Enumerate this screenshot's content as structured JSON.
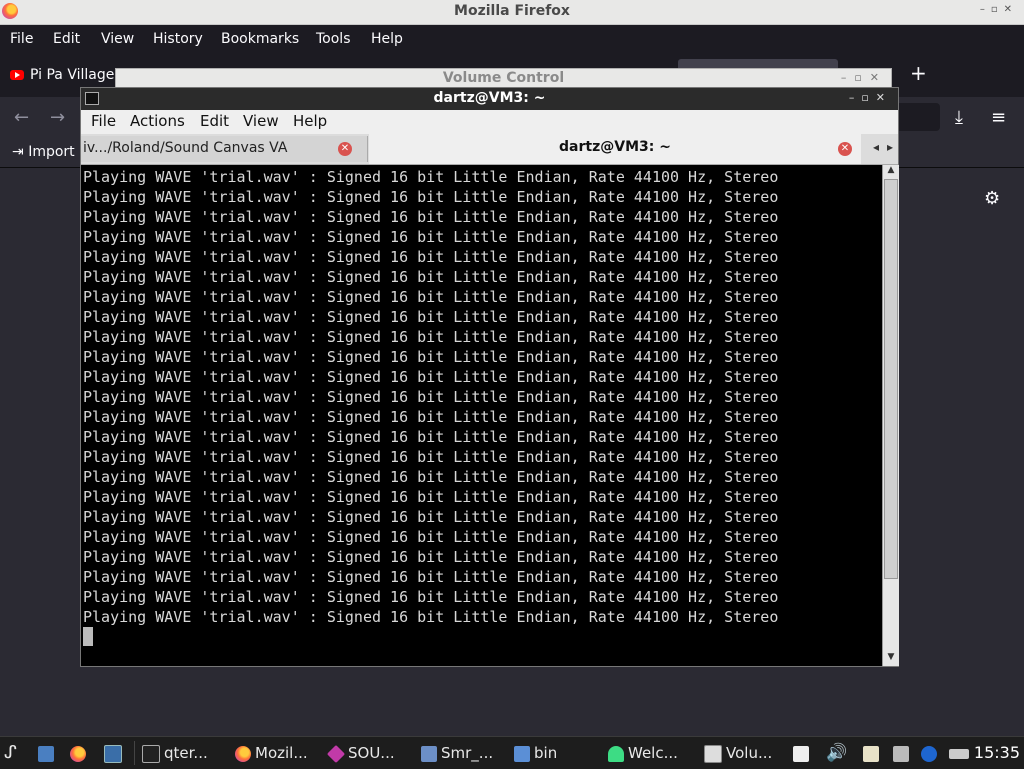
{
  "firefox": {
    "window_title": "Mozilla Firefox",
    "menu": [
      "File",
      "Edit",
      "View",
      "History",
      "Bookmarks",
      "Tools",
      "Help"
    ],
    "tab_label": "Pi Pa Village",
    "bookmark_label": "Import"
  },
  "volume_control": {
    "window_title": "Volume Control"
  },
  "terminal": {
    "window_title": "dartz@VM3: ~",
    "menu": [
      "File",
      "Actions",
      "Edit",
      "View",
      "Help"
    ],
    "tabs": [
      {
        "label": "iv.../Roland/Sound Canvas VA"
      },
      {
        "label": "dartz@VM3: ~"
      }
    ],
    "output_lines": [
      "Playing WAVE 'trial.wav' : Signed 16 bit Little Endian, Rate 44100 Hz, Stereo",
      "Playing WAVE 'trial.wav' : Signed 16 bit Little Endian, Rate 44100 Hz, Stereo",
      "Playing WAVE 'trial.wav' : Signed 16 bit Little Endian, Rate 44100 Hz, Stereo",
      "Playing WAVE 'trial.wav' : Signed 16 bit Little Endian, Rate 44100 Hz, Stereo",
      "Playing WAVE 'trial.wav' : Signed 16 bit Little Endian, Rate 44100 Hz, Stereo",
      "Playing WAVE 'trial.wav' : Signed 16 bit Little Endian, Rate 44100 Hz, Stereo",
      "Playing WAVE 'trial.wav' : Signed 16 bit Little Endian, Rate 44100 Hz, Stereo",
      "Playing WAVE 'trial.wav' : Signed 16 bit Little Endian, Rate 44100 Hz, Stereo",
      "Playing WAVE 'trial.wav' : Signed 16 bit Little Endian, Rate 44100 Hz, Stereo",
      "Playing WAVE 'trial.wav' : Signed 16 bit Little Endian, Rate 44100 Hz, Stereo",
      "Playing WAVE 'trial.wav' : Signed 16 bit Little Endian, Rate 44100 Hz, Stereo",
      "Playing WAVE 'trial.wav' : Signed 16 bit Little Endian, Rate 44100 Hz, Stereo",
      "Playing WAVE 'trial.wav' : Signed 16 bit Little Endian, Rate 44100 Hz, Stereo",
      "Playing WAVE 'trial.wav' : Signed 16 bit Little Endian, Rate 44100 Hz, Stereo",
      "Playing WAVE 'trial.wav' : Signed 16 bit Little Endian, Rate 44100 Hz, Stereo",
      "Playing WAVE 'trial.wav' : Signed 16 bit Little Endian, Rate 44100 Hz, Stereo",
      "Playing WAVE 'trial.wav' : Signed 16 bit Little Endian, Rate 44100 Hz, Stereo",
      "Playing WAVE 'trial.wav' : Signed 16 bit Little Endian, Rate 44100 Hz, Stereo",
      "Playing WAVE 'trial.wav' : Signed 16 bit Little Endian, Rate 44100 Hz, Stereo",
      "Playing WAVE 'trial.wav' : Signed 16 bit Little Endian, Rate 44100 Hz, Stereo",
      "Playing WAVE 'trial.wav' : Signed 16 bit Little Endian, Rate 44100 Hz, Stereo",
      "Playing WAVE 'trial.wav' : Signed 16 bit Little Endian, Rate 44100 Hz, Stereo",
      "Playing WAVE 'trial.wav' : Signed 16 bit Little Endian, Rate 44100 Hz, Stereo"
    ]
  },
  "taskbar": {
    "items": [
      {
        "label": "qter...",
        "icon": "terminal-icon"
      },
      {
        "label": "Mozil...",
        "icon": "firefox-icon"
      },
      {
        "label": "SOU...",
        "icon": "diamond-icon"
      },
      {
        "label": "Smr_...",
        "icon": "app-icon"
      },
      {
        "label": "bin",
        "icon": "folder-icon"
      },
      {
        "label": "Welc...",
        "icon": "android-icon"
      },
      {
        "label": "Volu...",
        "icon": "volume-app-icon"
      }
    ],
    "clock": "15:35"
  },
  "colors": {
    "firefox_dark": "#1c1b22",
    "terminal_bg": "#000000",
    "terminal_fg": "#d8d8d8",
    "close_red": "#d9534f"
  }
}
